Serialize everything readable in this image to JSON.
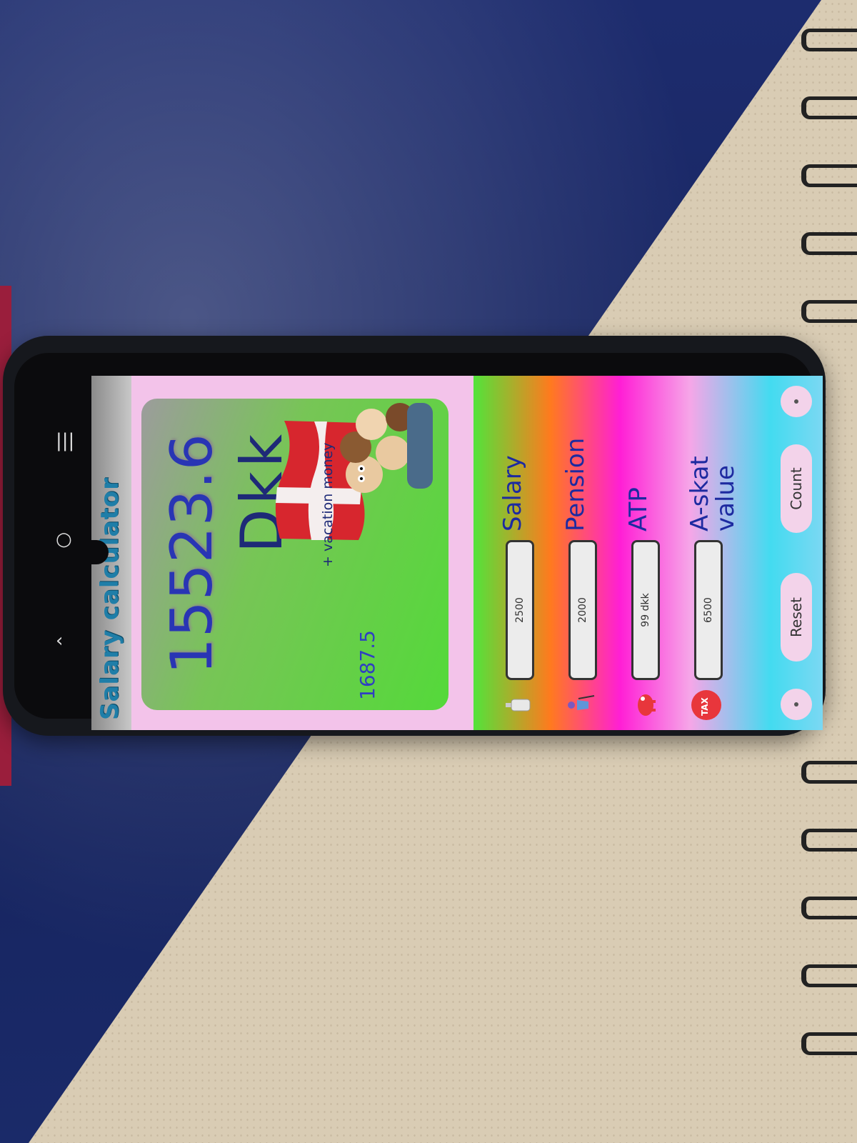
{
  "app": {
    "title": "Salary calculator"
  },
  "result": {
    "value": "15523.6",
    "currency": "Dkk",
    "vacation_label": "+ vacation money",
    "vacation_value": "1687.5"
  },
  "form": {
    "rows": [
      {
        "label": "Salary",
        "value": "2500",
        "icon": "bottle-icon"
      },
      {
        "label": "Pension",
        "value": "2000",
        "icon": "elderly-person-icon"
      },
      {
        "label": "ATP",
        "value": "99 dkk",
        "icon": "piggy-bank-icon"
      },
      {
        "label": "A-skat value",
        "value": "6500",
        "icon": "tax-icon"
      }
    ],
    "tax_badge": "TAX",
    "count_button": "Count",
    "reset_button": "Reset"
  },
  "colors": {
    "title": "#1f7ea8",
    "result_value": "#2935b4",
    "label": "#1d2aa0",
    "card_green": "#54d93a"
  }
}
